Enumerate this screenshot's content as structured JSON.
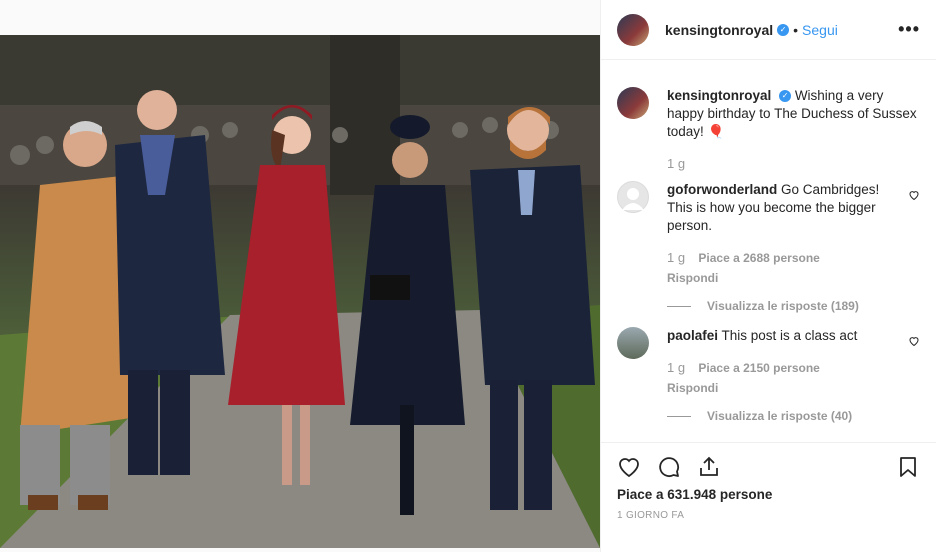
{
  "post": {
    "username": "kensingtonroyal",
    "follow_label": "Segui",
    "dot": "•",
    "more_label": "•••"
  },
  "caption": {
    "username": "kensingtonroyal",
    "text": "Wishing a very happy birthday to The Duchess of Sussex today! 🎈",
    "time": "1 g"
  },
  "comments": [
    {
      "username": "goforwonderland",
      "text": "Go Cambridges! This is how you become the bigger person.",
      "time": "1 g",
      "likes": "Piace a 2688 persone",
      "reply": "Rispondi",
      "view_replies": "Visualizza le risposte (189)"
    },
    {
      "username": "paolafei",
      "text": "This post is a class act",
      "time": "1 g",
      "likes": "Piace a 2150 persone",
      "reply": "Rispondi",
      "view_replies": "Visualizza le risposte (40)"
    }
  ],
  "footer": {
    "likes": "Piace a 631.948 persone",
    "ago": "1 GIORNO FA"
  },
  "colors": {
    "link": "#3897f0",
    "muted": "#999999",
    "text": "#262626"
  }
}
